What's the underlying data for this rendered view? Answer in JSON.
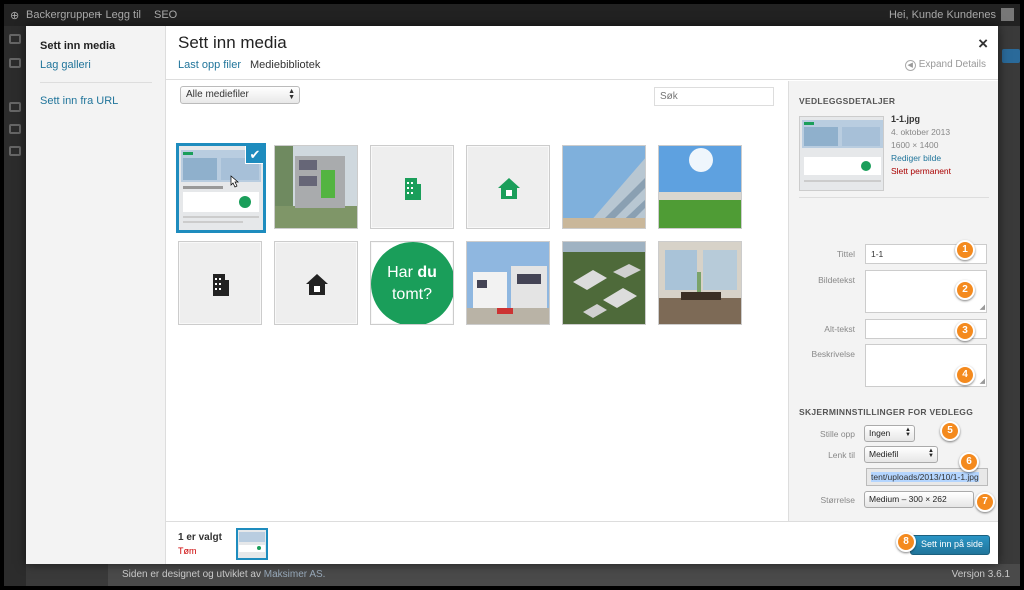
{
  "admin_bar": {
    "site_name": "Backergruppen",
    "add_new": "+ Legg til",
    "seo": "SEO",
    "greeting": "Hei, Kunde Kundenes"
  },
  "footer": {
    "credit_prefix": "Siden er designet og utviklet av",
    "credit_link": "Maksimer AS.",
    "version": "Versjon 3.6.1"
  },
  "modal": {
    "title": "Sett inn media",
    "close": "×",
    "menu": [
      "Sett inn media",
      "Lag galleri",
      "Sett inn fra URL"
    ],
    "tabs": [
      "Last opp filer",
      "Mediebibliotek"
    ],
    "expand_details": "Expand Details",
    "filter": {
      "selected": "Alle mediefiler"
    },
    "search": {
      "placeholder": "Søk"
    },
    "attachments": [
      {
        "kind": "screenshot",
        "selected": true,
        "icon": "check-icon"
      },
      {
        "kind": "photo-building-green"
      },
      {
        "kind": "icon",
        "icon": "building-icon",
        "color": "#1a9e5a"
      },
      {
        "kind": "icon",
        "icon": "house-icon",
        "color": "#1a9e5a"
      },
      {
        "kind": "photo-glass-facade"
      },
      {
        "kind": "photo-residential-park"
      },
      {
        "kind": "icon",
        "icon": "building-icon",
        "color": "#222222"
      },
      {
        "kind": "icon",
        "icon": "house-icon",
        "color": "#222222"
      },
      {
        "kind": "circle",
        "text_line1_a": "Har ",
        "text_line1_b": "du",
        "text_line2": "tomt?",
        "color": "#1a9e5a"
      },
      {
        "kind": "photo-modern-houses"
      },
      {
        "kind": "photo-aerial-render"
      },
      {
        "kind": "photo-interior"
      }
    ]
  },
  "details": {
    "heading": "VEDLEGGSDETALJER",
    "filename": "1-1.jpg",
    "date": "4. oktober 2013",
    "dimensions": "1600 × 1400",
    "edit_image": "Rediger bilde",
    "delete_permanently": "Slett permanent",
    "fields": {
      "title_label": "Tittel",
      "title_value": "1-1",
      "caption_label": "Bildetekst",
      "alt_label": "Alt-tekst",
      "description_label": "Beskrivelse"
    },
    "display_heading": "SKJERMINNSTILLINGER FOR VEDLEGG",
    "display": {
      "align_label": "Stille opp",
      "align_value": "Ingen",
      "link_label": "Lenk til",
      "link_value": "Mediefil",
      "link_url": "tent/uploads/2013/10/1-1.jpg",
      "size_label": "Størrelse",
      "size_value": "Medium – 300 × 262"
    }
  },
  "badges": [
    "1",
    "2",
    "3",
    "4",
    "5",
    "6",
    "7",
    "8"
  ],
  "toolbar": {
    "selected_count": "1 er valgt",
    "clear": "Tøm",
    "insert": "Sett inn på side"
  },
  "colors": {
    "accent": "#21759b",
    "selection": "#1e8cbe",
    "badge": "#f48a1e",
    "brand_green": "#1a9e5a"
  }
}
